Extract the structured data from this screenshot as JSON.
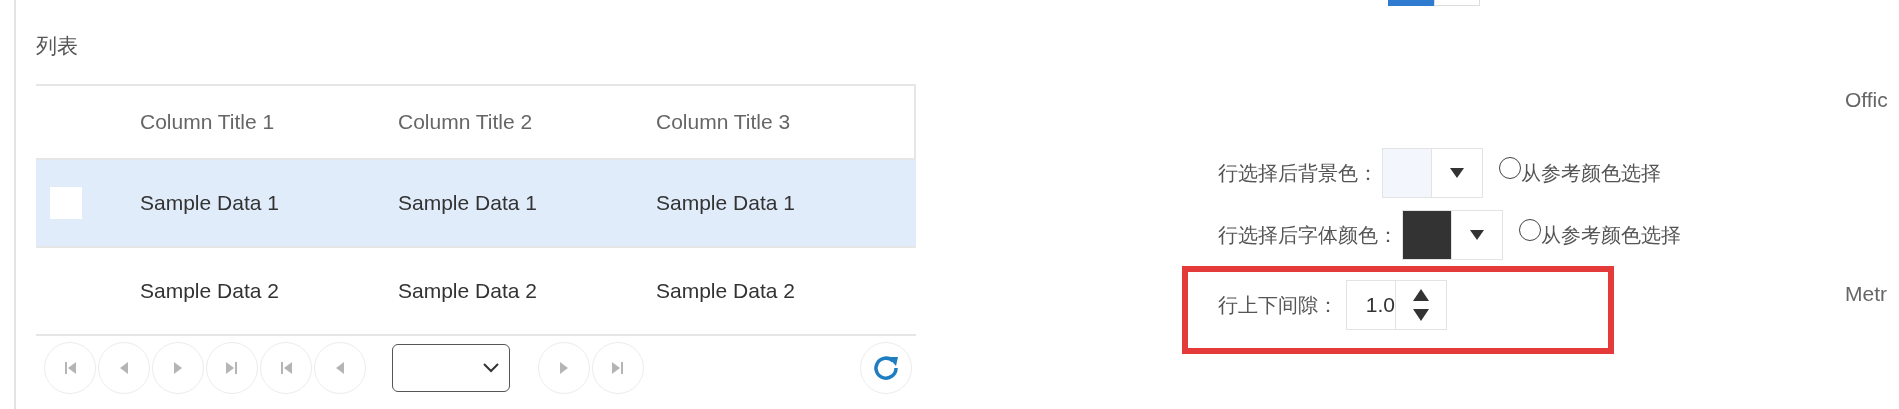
{
  "section_title": "列表",
  "table": {
    "columns": [
      "Column Title 1",
      "Column Title 2",
      "Column Title 3"
    ],
    "rows": [
      {
        "selected": true,
        "cells": [
          "Sample Data 1",
          "Sample Data 1",
          "Sample Data 1"
        ]
      },
      {
        "selected": false,
        "cells": [
          "Sample Data 2",
          "Sample Data 2",
          "Sample Data 2"
        ]
      }
    ]
  },
  "pager": {
    "buttons_before": [
      {
        "kind": "first",
        "disabled": true
      },
      {
        "kind": "prev",
        "disabled": true
      },
      {
        "kind": "next",
        "disabled": true
      },
      {
        "kind": "last",
        "disabled": true
      },
      {
        "kind": "first",
        "disabled": true
      },
      {
        "kind": "prev",
        "disabled": true
      }
    ],
    "buttons_after": [
      {
        "kind": "next",
        "disabled": true
      },
      {
        "kind": "last",
        "disabled": true
      }
    ]
  },
  "toggle": {
    "segments": [
      {
        "selected": true
      },
      {
        "selected": false
      }
    ]
  },
  "settings": [
    {
      "kind": "color",
      "label": "行选择后背景色：",
      "color": "#f3f7fd",
      "option": "从参考颜色选择",
      "checked": false,
      "highlighted": false
    },
    {
      "kind": "color",
      "label": "行选择后字体颜色：",
      "color": "#333333",
      "option": "从参考颜色选择",
      "checked": false,
      "highlighted": false
    },
    {
      "kind": "spinner",
      "label": "行上下间隙：",
      "value": "1.0",
      "highlighted": true
    }
  ],
  "side_labels": [
    "Offic",
    "Metr"
  ]
}
